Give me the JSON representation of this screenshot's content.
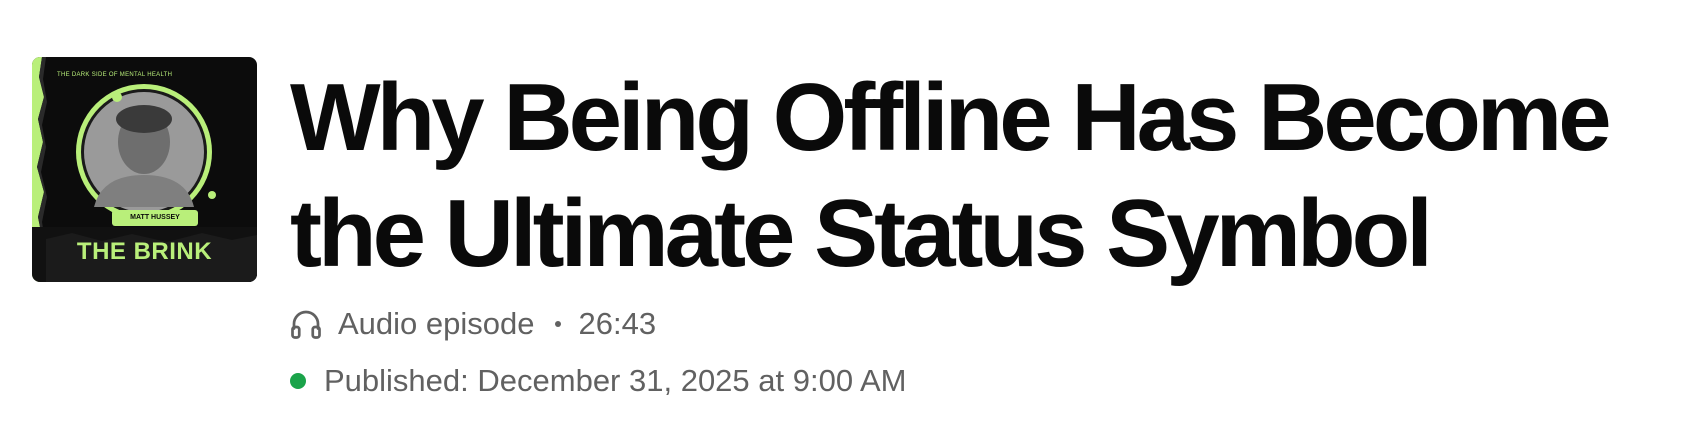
{
  "cover": {
    "tagline": "THE DARK SIDE OF MENTAL HEALTH",
    "host": "MATT HUSSEY",
    "show_title": "THE BRINK",
    "accent_color": "#b9ef7a",
    "background_color": "#0c0c0c"
  },
  "episode": {
    "title": "Why Being Offline Has Become the Ultimate Status Symbol",
    "type_icon": "headphones-icon",
    "type_label": "Audio episode",
    "duration": "26:43",
    "published": "Published: December 31, 2025 at 9:00 AM",
    "published_status_color": "#1aa34a"
  }
}
